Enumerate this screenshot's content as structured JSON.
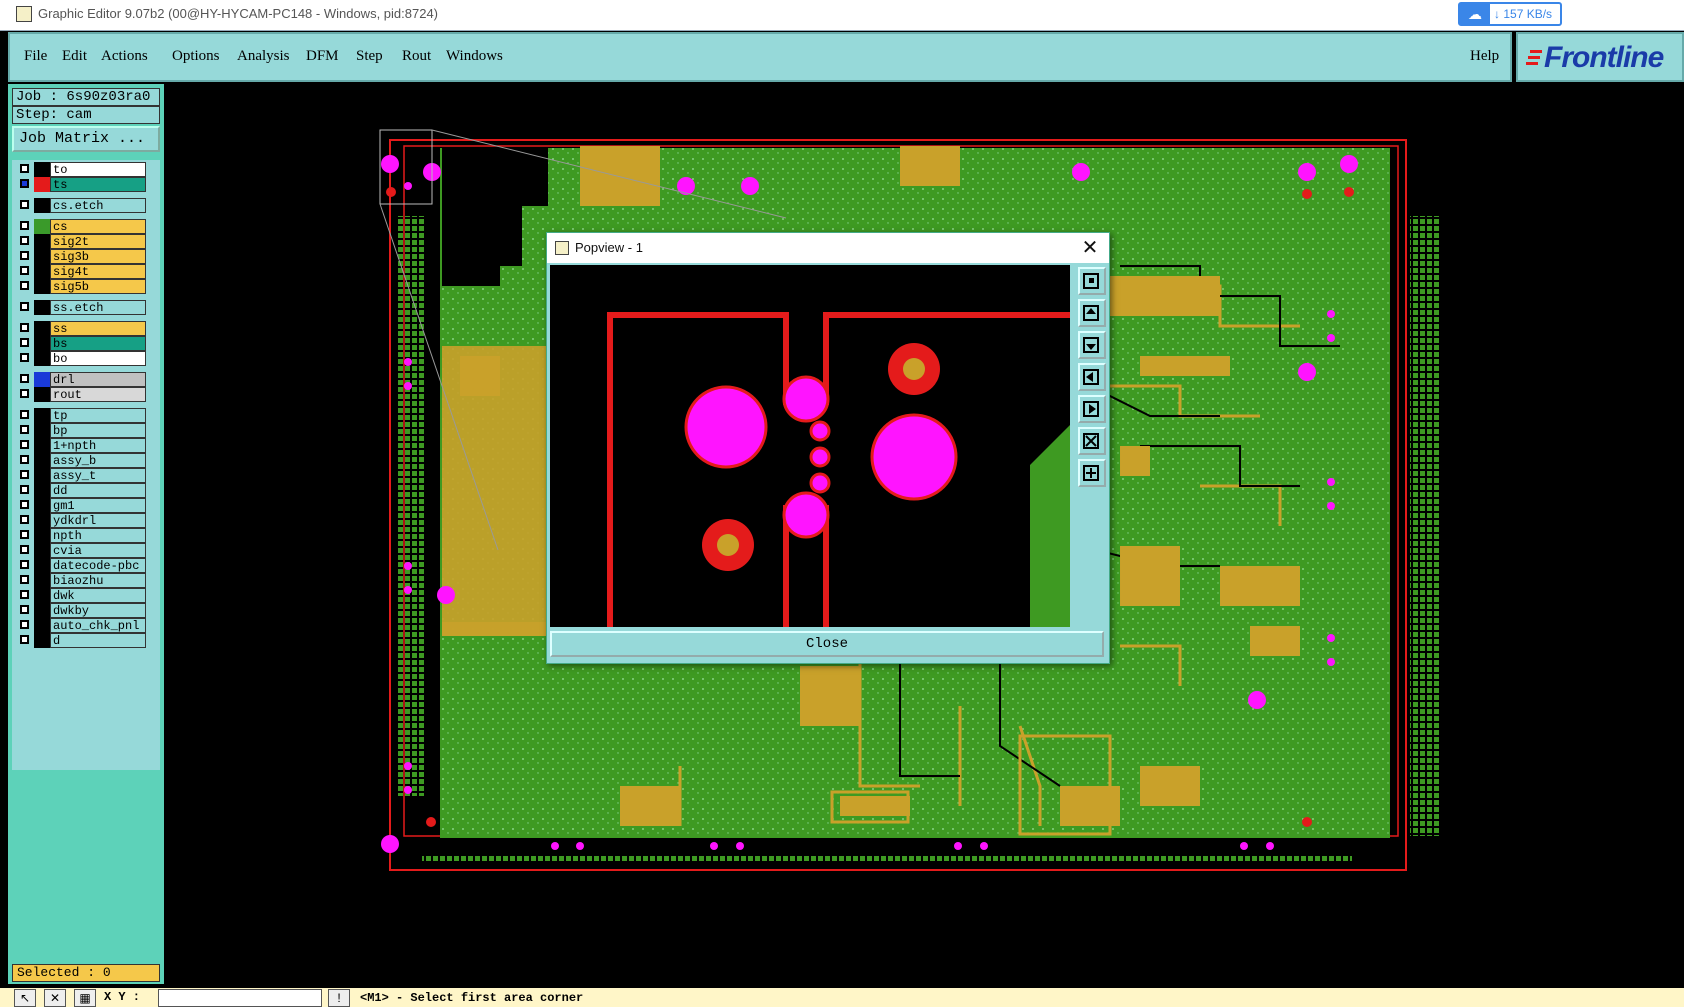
{
  "window": {
    "title": "Graphic Editor 9.07b2 (00@HY-HYCAM-PC148 - Windows, pid:8724)",
    "net_speed": "157 KB/s"
  },
  "menu": {
    "items": [
      "File",
      "Edit",
      "Actions",
      "Options",
      "Analysis",
      "DFM",
      "Step",
      "Rout",
      "Windows"
    ],
    "help": "Help",
    "brand": "Frontline"
  },
  "job": {
    "job_line": "Job : 6s90z03ra0",
    "step_line": "Step: cam",
    "matrix_button": "Job Matrix ..."
  },
  "layers": [
    {
      "name": "to",
      "bg": "#ffffff",
      "swatch": "#000000"
    },
    {
      "name": "ts",
      "bg": "#16a085",
      "swatch": "#e41b1b",
      "selected": true
    },
    {
      "name": "cs.etch",
      "bg": "#96d9d9",
      "swatch": "#000000"
    },
    {
      "name": "cs",
      "bg": "#f5c84a",
      "swatch": "#3a9a2a"
    },
    {
      "name": "sig2t",
      "bg": "#f5c84a",
      "swatch": "#000000"
    },
    {
      "name": "sig3b",
      "bg": "#f5c84a",
      "swatch": "#000000"
    },
    {
      "name": "sig4t",
      "bg": "#f5c84a",
      "swatch": "#000000"
    },
    {
      "name": "sig5b",
      "bg": "#f5c84a",
      "swatch": "#000000"
    },
    {
      "name": "ss.etch",
      "bg": "#96d9d9",
      "swatch": "#000000"
    },
    {
      "name": "ss",
      "bg": "#f5c84a",
      "swatch": "#000000"
    },
    {
      "name": "bs",
      "bg": "#16a085",
      "swatch": "#000000"
    },
    {
      "name": "bo",
      "bg": "#ffffff",
      "swatch": "#000000"
    },
    {
      "name": "drl",
      "bg": "#c0c0c0",
      "swatch": "#1a3ad8"
    },
    {
      "name": "rout",
      "bg": "#d8d8d8",
      "swatch": "#000000"
    },
    {
      "name": "tp",
      "bg": "#96d9d9",
      "swatch": "#000000"
    },
    {
      "name": "bp",
      "bg": "#96d9d9",
      "swatch": "#000000"
    },
    {
      "name": "1+npth",
      "bg": "#96d9d9",
      "swatch": "#000000"
    },
    {
      "name": "assy_b",
      "bg": "#96d9d9",
      "swatch": "#000000"
    },
    {
      "name": "assy_t",
      "bg": "#96d9d9",
      "swatch": "#000000"
    },
    {
      "name": "dd",
      "bg": "#96d9d9",
      "swatch": "#000000"
    },
    {
      "name": "gm1",
      "bg": "#96d9d9",
      "swatch": "#000000"
    },
    {
      "name": "ydkdrl",
      "bg": "#96d9d9",
      "swatch": "#000000"
    },
    {
      "name": "npth",
      "bg": "#96d9d9",
      "swatch": "#000000"
    },
    {
      "name": "cvia",
      "bg": "#96d9d9",
      "swatch": "#000000"
    },
    {
      "name": "datecode-pbc",
      "bg": "#96d9d9",
      "swatch": "#000000"
    },
    {
      "name": "biaozhu",
      "bg": "#96d9d9",
      "swatch": "#000000"
    },
    {
      "name": "dwk",
      "bg": "#96d9d9",
      "swatch": "#000000"
    },
    {
      "name": "dwkby",
      "bg": "#96d9d9",
      "swatch": "#000000"
    },
    {
      "name": "auto_chk_pnl",
      "bg": "#96d9d9",
      "swatch": "#000000"
    },
    {
      "name": "d",
      "bg": "#96d9d9",
      "swatch": "#000000"
    }
  ],
  "status": {
    "selected": "Selected : 0",
    "xy_label": "X Y :",
    "message": "<M1> - Select first area corner"
  },
  "popview": {
    "title": "Popview - 1",
    "close_label": "Close",
    "close_x": "✕",
    "tools": [
      "zoom-home-icon",
      "pan-up-icon",
      "pan-down-icon",
      "pan-left-icon",
      "pan-right-icon",
      "zoom-fit-icon",
      "zoom-area-icon"
    ]
  },
  "colors": {
    "board_green": "#3e9a22",
    "trace_copper": "#c9a12a",
    "outline_red": "#e41b1b",
    "pad_magenta": "#ff14ff",
    "panel_teal": "#96d9d9"
  }
}
